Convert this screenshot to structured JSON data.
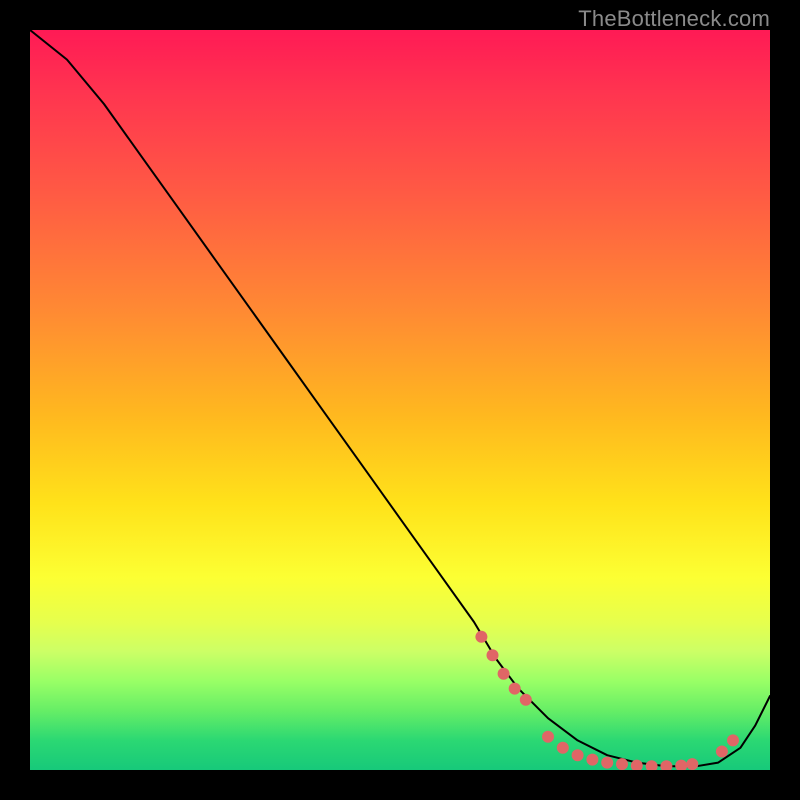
{
  "watermark": "TheBottleneck.com",
  "chart_data": {
    "type": "line",
    "title": "",
    "xlabel": "",
    "ylabel": "",
    "xlim": [
      0,
      100
    ],
    "ylim": [
      0,
      100
    ],
    "grid": false,
    "legend": false,
    "background": "heatmap-gradient-red-to-green-vertical",
    "series": [
      {
        "name": "bottleneck-curve",
        "x": [
          0,
          5,
          10,
          15,
          20,
          25,
          30,
          35,
          40,
          45,
          50,
          55,
          60,
          63,
          66,
          70,
          74,
          78,
          82,
          86,
          90,
          93,
          96,
          98,
          100
        ],
        "y": [
          100,
          96,
          90,
          83,
          76,
          69,
          62,
          55,
          48,
          41,
          34,
          27,
          20,
          15,
          11,
          7,
          4,
          2,
          1,
          0.5,
          0.5,
          1,
          3,
          6,
          10
        ],
        "stroke": "#000000",
        "width": 2
      }
    ],
    "markers": [
      {
        "name": "highlighted-points",
        "color": "#e06666",
        "radius": 6,
        "points": [
          {
            "x": 61,
            "y": 18
          },
          {
            "x": 62.5,
            "y": 15.5
          },
          {
            "x": 64,
            "y": 13
          },
          {
            "x": 65.5,
            "y": 11
          },
          {
            "x": 67,
            "y": 9.5
          },
          {
            "x": 70,
            "y": 4.5
          },
          {
            "x": 72,
            "y": 3
          },
          {
            "x": 74,
            "y": 2
          },
          {
            "x": 76,
            "y": 1.4
          },
          {
            "x": 78,
            "y": 1
          },
          {
            "x": 80,
            "y": 0.8
          },
          {
            "x": 82,
            "y": 0.6
          },
          {
            "x": 84,
            "y": 0.5
          },
          {
            "x": 86,
            "y": 0.5
          },
          {
            "x": 88,
            "y": 0.6
          },
          {
            "x": 89.5,
            "y": 0.8
          },
          {
            "x": 93.5,
            "y": 2.5
          },
          {
            "x": 95,
            "y": 4
          }
        ]
      }
    ]
  }
}
